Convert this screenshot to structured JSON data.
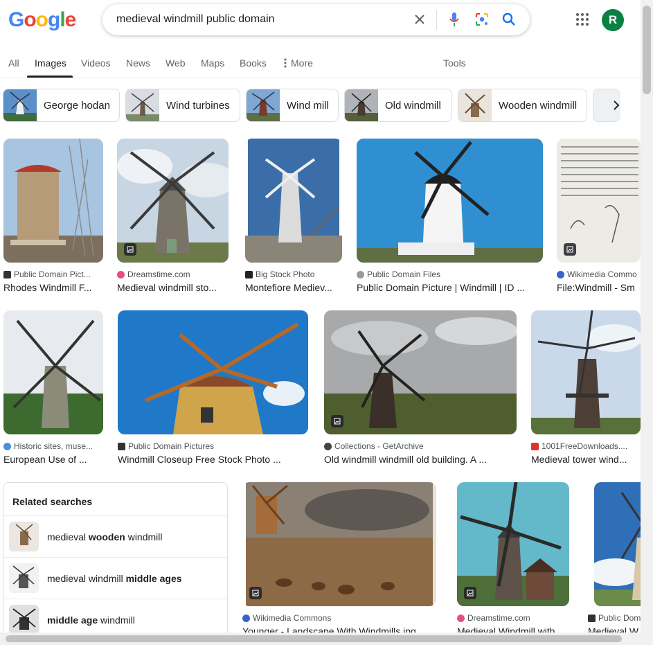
{
  "search": {
    "query": "medieval windmill public domain"
  },
  "header": {
    "logo_letters": [
      "G",
      "o",
      "o",
      "g",
      "l",
      "e"
    ],
    "avatar_letter": "R"
  },
  "tabs": [
    {
      "label": "All"
    },
    {
      "label": "Images"
    },
    {
      "label": "Videos"
    },
    {
      "label": "News"
    },
    {
      "label": "Web"
    },
    {
      "label": "Maps"
    },
    {
      "label": "Books"
    },
    {
      "label": "More"
    },
    {
      "label": "Tools"
    }
  ],
  "chips": [
    {
      "label": "George hodan"
    },
    {
      "label": "Wind turbines"
    },
    {
      "label": "Wind mill"
    },
    {
      "label": "Old windmill"
    },
    {
      "label": "Wooden windmill"
    }
  ],
  "results": [
    {
      "source": "Public Domain Pict...",
      "title": "Rhodes Windmill F..."
    },
    {
      "source": "Dreamstime.com",
      "title": "Medieval windmill sto..."
    },
    {
      "source": "Big Stock Photo",
      "title": "Montefiore Mediev..."
    },
    {
      "source": "Public Domain Files",
      "title": "Public Domain Picture | Windmill | ID ..."
    },
    {
      "source": "Wikimedia Commo",
      "title": "File:Windmill - Sm"
    },
    {
      "source": "Historic sites, muse...",
      "title": "European Use of ..."
    },
    {
      "source": "Public Domain Pictures",
      "title": "Windmill Closeup Free Stock Photo ..."
    },
    {
      "source": "Collections - GetArchive",
      "title": "Old windmill windmill old building. A ..."
    },
    {
      "source": "1001FreeDownloads....",
      "title": "Medieval tower wind..."
    },
    {
      "source": "Wikimedia Commons",
      "title": "Younger - Landscape With Windmills.jpg"
    },
    {
      "source": "Dreamstime.com",
      "title": "Medieval Windmill with"
    },
    {
      "source": "Public Dom",
      "title": "Medieval W"
    }
  ],
  "related": {
    "heading": "Related searches",
    "items": [
      {
        "pre": "medieval ",
        "bold": "wooden",
        "post": " windmill"
      },
      {
        "pre": "medieval windmill ",
        "bold": "middle ages",
        "post": ""
      },
      {
        "pre": "",
        "bold": "middle age",
        "post": " windmill"
      }
    ]
  },
  "colors": {
    "accent": "#1a73e8",
    "text": "#202124",
    "muted": "#5f6368",
    "avatar": "#0b8043"
  },
  "icons": [
    "clear-icon",
    "mic-icon",
    "lens-icon",
    "search-icon",
    "apps-icon",
    "more-dots-icon",
    "chevron-right-icon",
    "image-badge-icon"
  ]
}
